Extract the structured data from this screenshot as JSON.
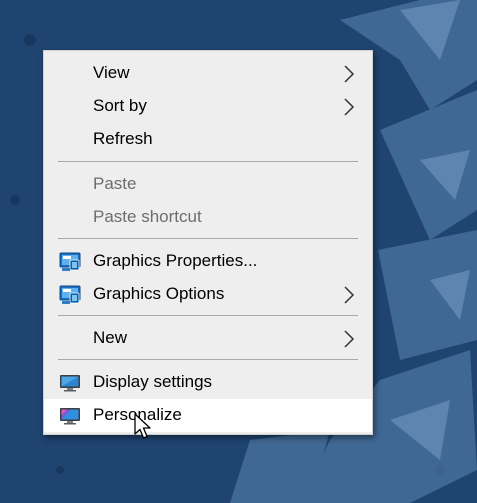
{
  "context_menu": {
    "items": [
      {
        "label": "View",
        "has_submenu": true,
        "disabled": false
      },
      {
        "label": "Sort by",
        "has_submenu": true,
        "disabled": false
      },
      {
        "label": "Refresh",
        "has_submenu": false,
        "disabled": false
      },
      {
        "label": "Paste",
        "has_submenu": false,
        "disabled": true
      },
      {
        "label": "Paste shortcut",
        "has_submenu": false,
        "disabled": true
      },
      {
        "label": "Graphics Properties...",
        "icon": "intel-graphics-icon",
        "has_submenu": false,
        "disabled": false
      },
      {
        "label": "Graphics Options",
        "icon": "intel-graphics-icon",
        "has_submenu": true,
        "disabled": false
      },
      {
        "label": "New",
        "has_submenu": true,
        "disabled": false
      },
      {
        "label": "Display settings",
        "icon": "display-monitor-icon",
        "has_submenu": false,
        "disabled": false
      },
      {
        "label": "Personalize",
        "icon": "personalize-monitor-icon",
        "has_submenu": false,
        "disabled": false,
        "hovered": true
      }
    ]
  },
  "colors": {
    "desktop_background": "#1f4470",
    "menu_background": "#eeeeee",
    "hover_background": "#ffffff",
    "disabled_text": "#6d6d6d",
    "separator": "#a9a9a9"
  }
}
